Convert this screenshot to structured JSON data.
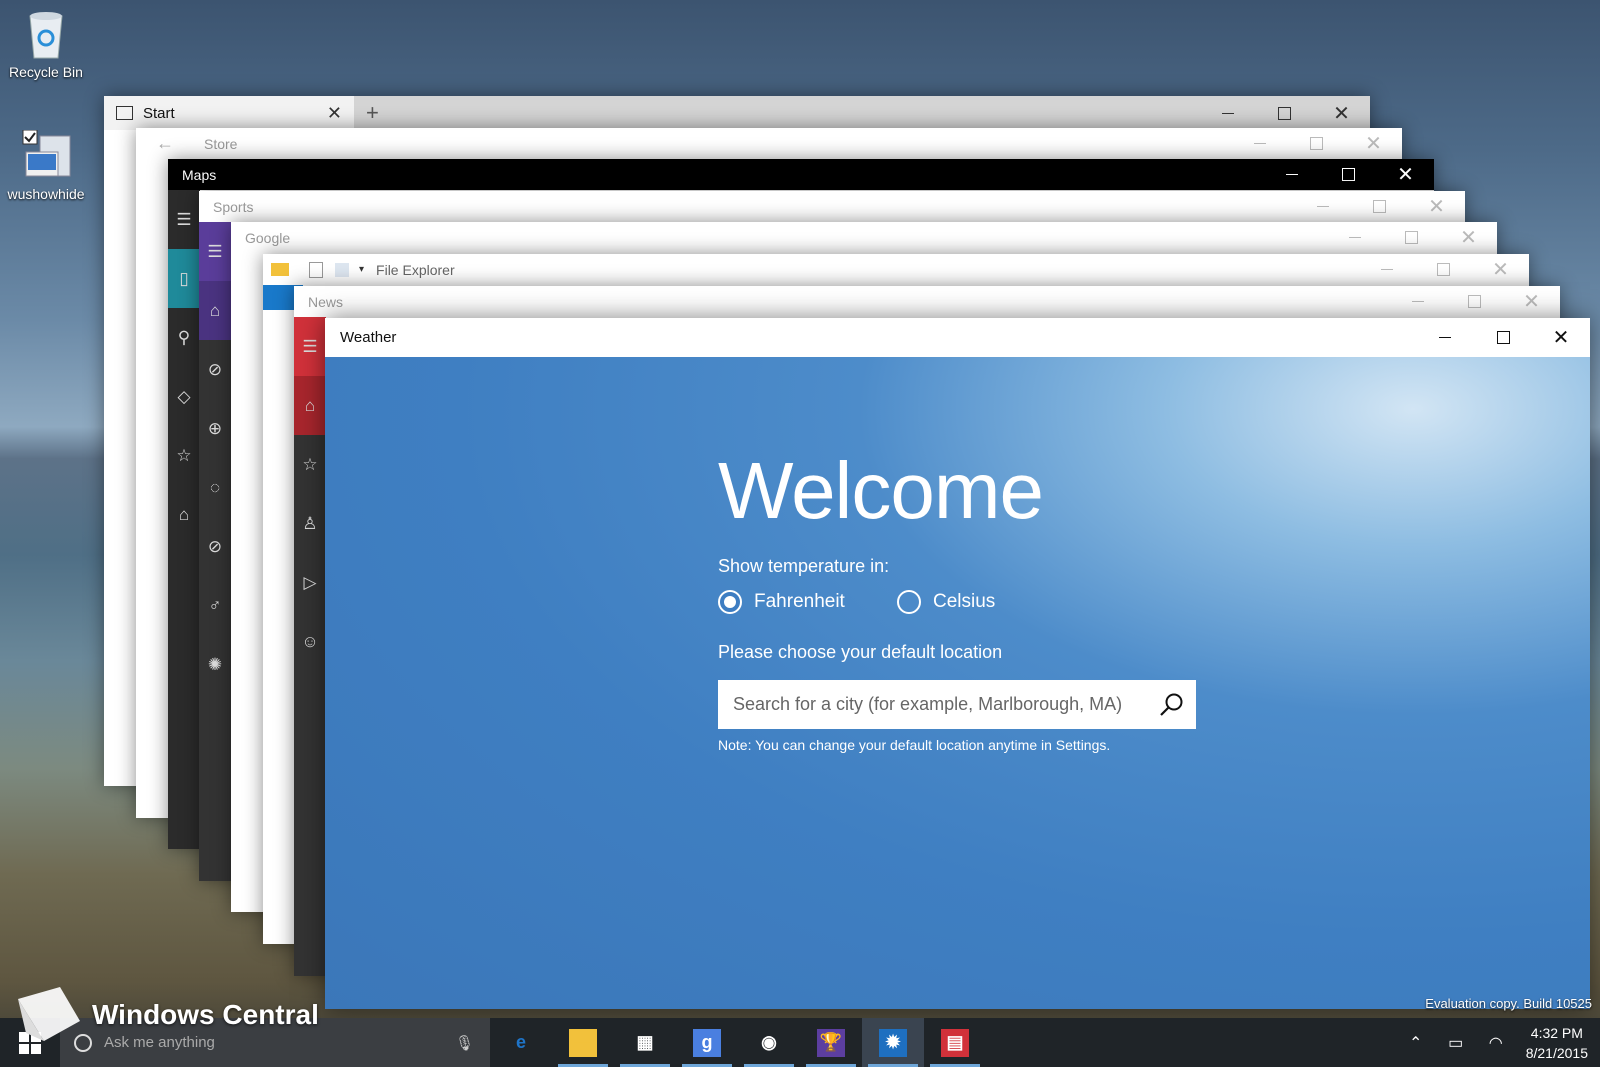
{
  "desktop": {
    "icons": [
      {
        "label": "Recycle Bin",
        "icon": "recycle-bin-icon"
      },
      {
        "label": "wushowhide",
        "icon": "app-shortcut-icon"
      }
    ],
    "watermark": "Evaluation copy. Build 10525"
  },
  "windows": {
    "start": {
      "title": "Start",
      "new_tab": "+"
    },
    "store": {
      "title": "Store"
    },
    "maps": {
      "title": "Maps"
    },
    "sports": {
      "title": "Sports"
    },
    "google": {
      "title": "Google"
    },
    "file_explorer": {
      "title": "File Explorer"
    },
    "news": {
      "title": "News"
    },
    "weather": {
      "title": "Weather"
    }
  },
  "weather_app": {
    "heading": "Welcome",
    "temp_label": "Show temperature in:",
    "options": [
      {
        "label": "Fahrenheit",
        "selected": true
      },
      {
        "label": "Celsius",
        "selected": false
      }
    ],
    "location_label": "Please choose your default location",
    "search_placeholder": "Search for a city (for example, Marlborough, MA)",
    "note": "Note: You can change your default location anytime in Settings."
  },
  "taskbar": {
    "search_placeholder": "Ask me anything",
    "apps": [
      {
        "name": "edge-icon",
        "glyph": "e",
        "color": "#1e74c8",
        "running": false
      },
      {
        "name": "file-explorer-icon",
        "glyph": "▬",
        "color": "#f2c13b",
        "running": true
      },
      {
        "name": "store-icon",
        "glyph": "▦",
        "color": "#ffffff",
        "running": true
      },
      {
        "name": "google-icon",
        "glyph": "g",
        "color": "#4a7fe0",
        "running": true
      },
      {
        "name": "maps-icon",
        "glyph": "◉",
        "color": "#ffffff",
        "running": true
      },
      {
        "name": "sports-icon",
        "glyph": "🏆",
        "color": "#5c3ea0",
        "running": true
      },
      {
        "name": "weather-icon",
        "glyph": "✹",
        "color": "#1e6fc0",
        "running": true
      },
      {
        "name": "news-icon",
        "glyph": "▤",
        "color": "#d1313a",
        "running": true
      }
    ],
    "time": "4:32 PM",
    "date": "8/21/2015"
  },
  "brand": {
    "text": "Windows Central"
  }
}
